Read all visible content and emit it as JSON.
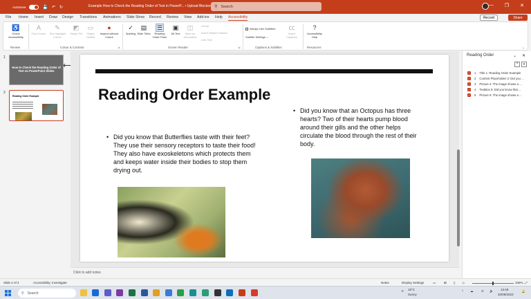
{
  "titlebar": {
    "autosave_label": "AutoSave",
    "doc_title": "Example How to Check the Reading Order of Text in PowerP... • Upload Blocked ⌄",
    "search_placeholder": "Search"
  },
  "menu": [
    "File",
    "Home",
    "Insert",
    "Draw",
    "Design",
    "Transitions",
    "Animations",
    "Slide Show",
    "Record",
    "Review",
    "View",
    "Add-ins",
    "Help",
    "Accessibility"
  ],
  "record_label": "Record",
  "share_label": "Share",
  "ribbon": {
    "check_accessibility": "Check Accessibility",
    "font_colour": "Font Colour",
    "text_highlight": "Text Highlight Colour",
    "shape_fill": "Shape Fill",
    "shape_outline": "Shape Outline",
    "inspect_colour": "Inspect without Colour",
    "spelling": "Spelling",
    "slide_titles": "Slide Titles",
    "reading_order": "Reading Order Pane",
    "alt_text": "Alt Text",
    "mark_decorative": "Mark as Decorative",
    "group": "Group",
    "insert_hidden": "Insert Hidden Header",
    "link_text": "Link Text",
    "always_subtitles": "Always Use Subtitles",
    "subtitle_settings": "Subtitle Settings",
    "insert_captions": "Insert Captions",
    "accessibility_help": "Accessibility Help",
    "groups": [
      "Review",
      "Colour & Contrast",
      "Screen Reader",
      "Captions & Subtitles",
      "Resources"
    ]
  },
  "thumbnails": {
    "slide1_num": "1",
    "slide1_title": "How to Check the Reading Order of Text on PowerPoint Slides",
    "slide2_num": "2",
    "slide2_title": "Reading Order Example"
  },
  "slide": {
    "title": "Reading Order Example",
    "left_text": "Did you know that Butterflies taste with their feet? They use their sensory receptors to taste their food! They also have exoskeletons which protects them and keeps water inside their bodies to stop them drying out.",
    "right_text": "Did you know that an Octopus has three hearts? Two of their hearts pump blood around their gills and the other helps circulate the blood through the rest of their body."
  },
  "notes_placeholder": "Click to add notes",
  "pane": {
    "title": "Reading Order",
    "items": [
      {
        "num": "1",
        "label": "Title 1: Reading Order Example"
      },
      {
        "num": "2",
        "label": "Content Placeholder 2: Did you ..."
      },
      {
        "num": "3",
        "label": "Picture 4: The image shows a ..."
      },
      {
        "num": "4",
        "label": "TextBox 5: Did you know that ..."
      },
      {
        "num": "5",
        "label": "Picture 6: The image shows a ..."
      }
    ]
  },
  "status": {
    "slide_info": "Slide 2 of 2",
    "accessibility": "Accessibility: Investigate",
    "notes": "Notes",
    "display_settings": "Display Settings",
    "zoom": "106%"
  },
  "taskbar": {
    "search": "Search",
    "weather_temp": "18°C",
    "weather_desc": "Sunny",
    "time": "13:49",
    "date": "20/09/2023"
  }
}
